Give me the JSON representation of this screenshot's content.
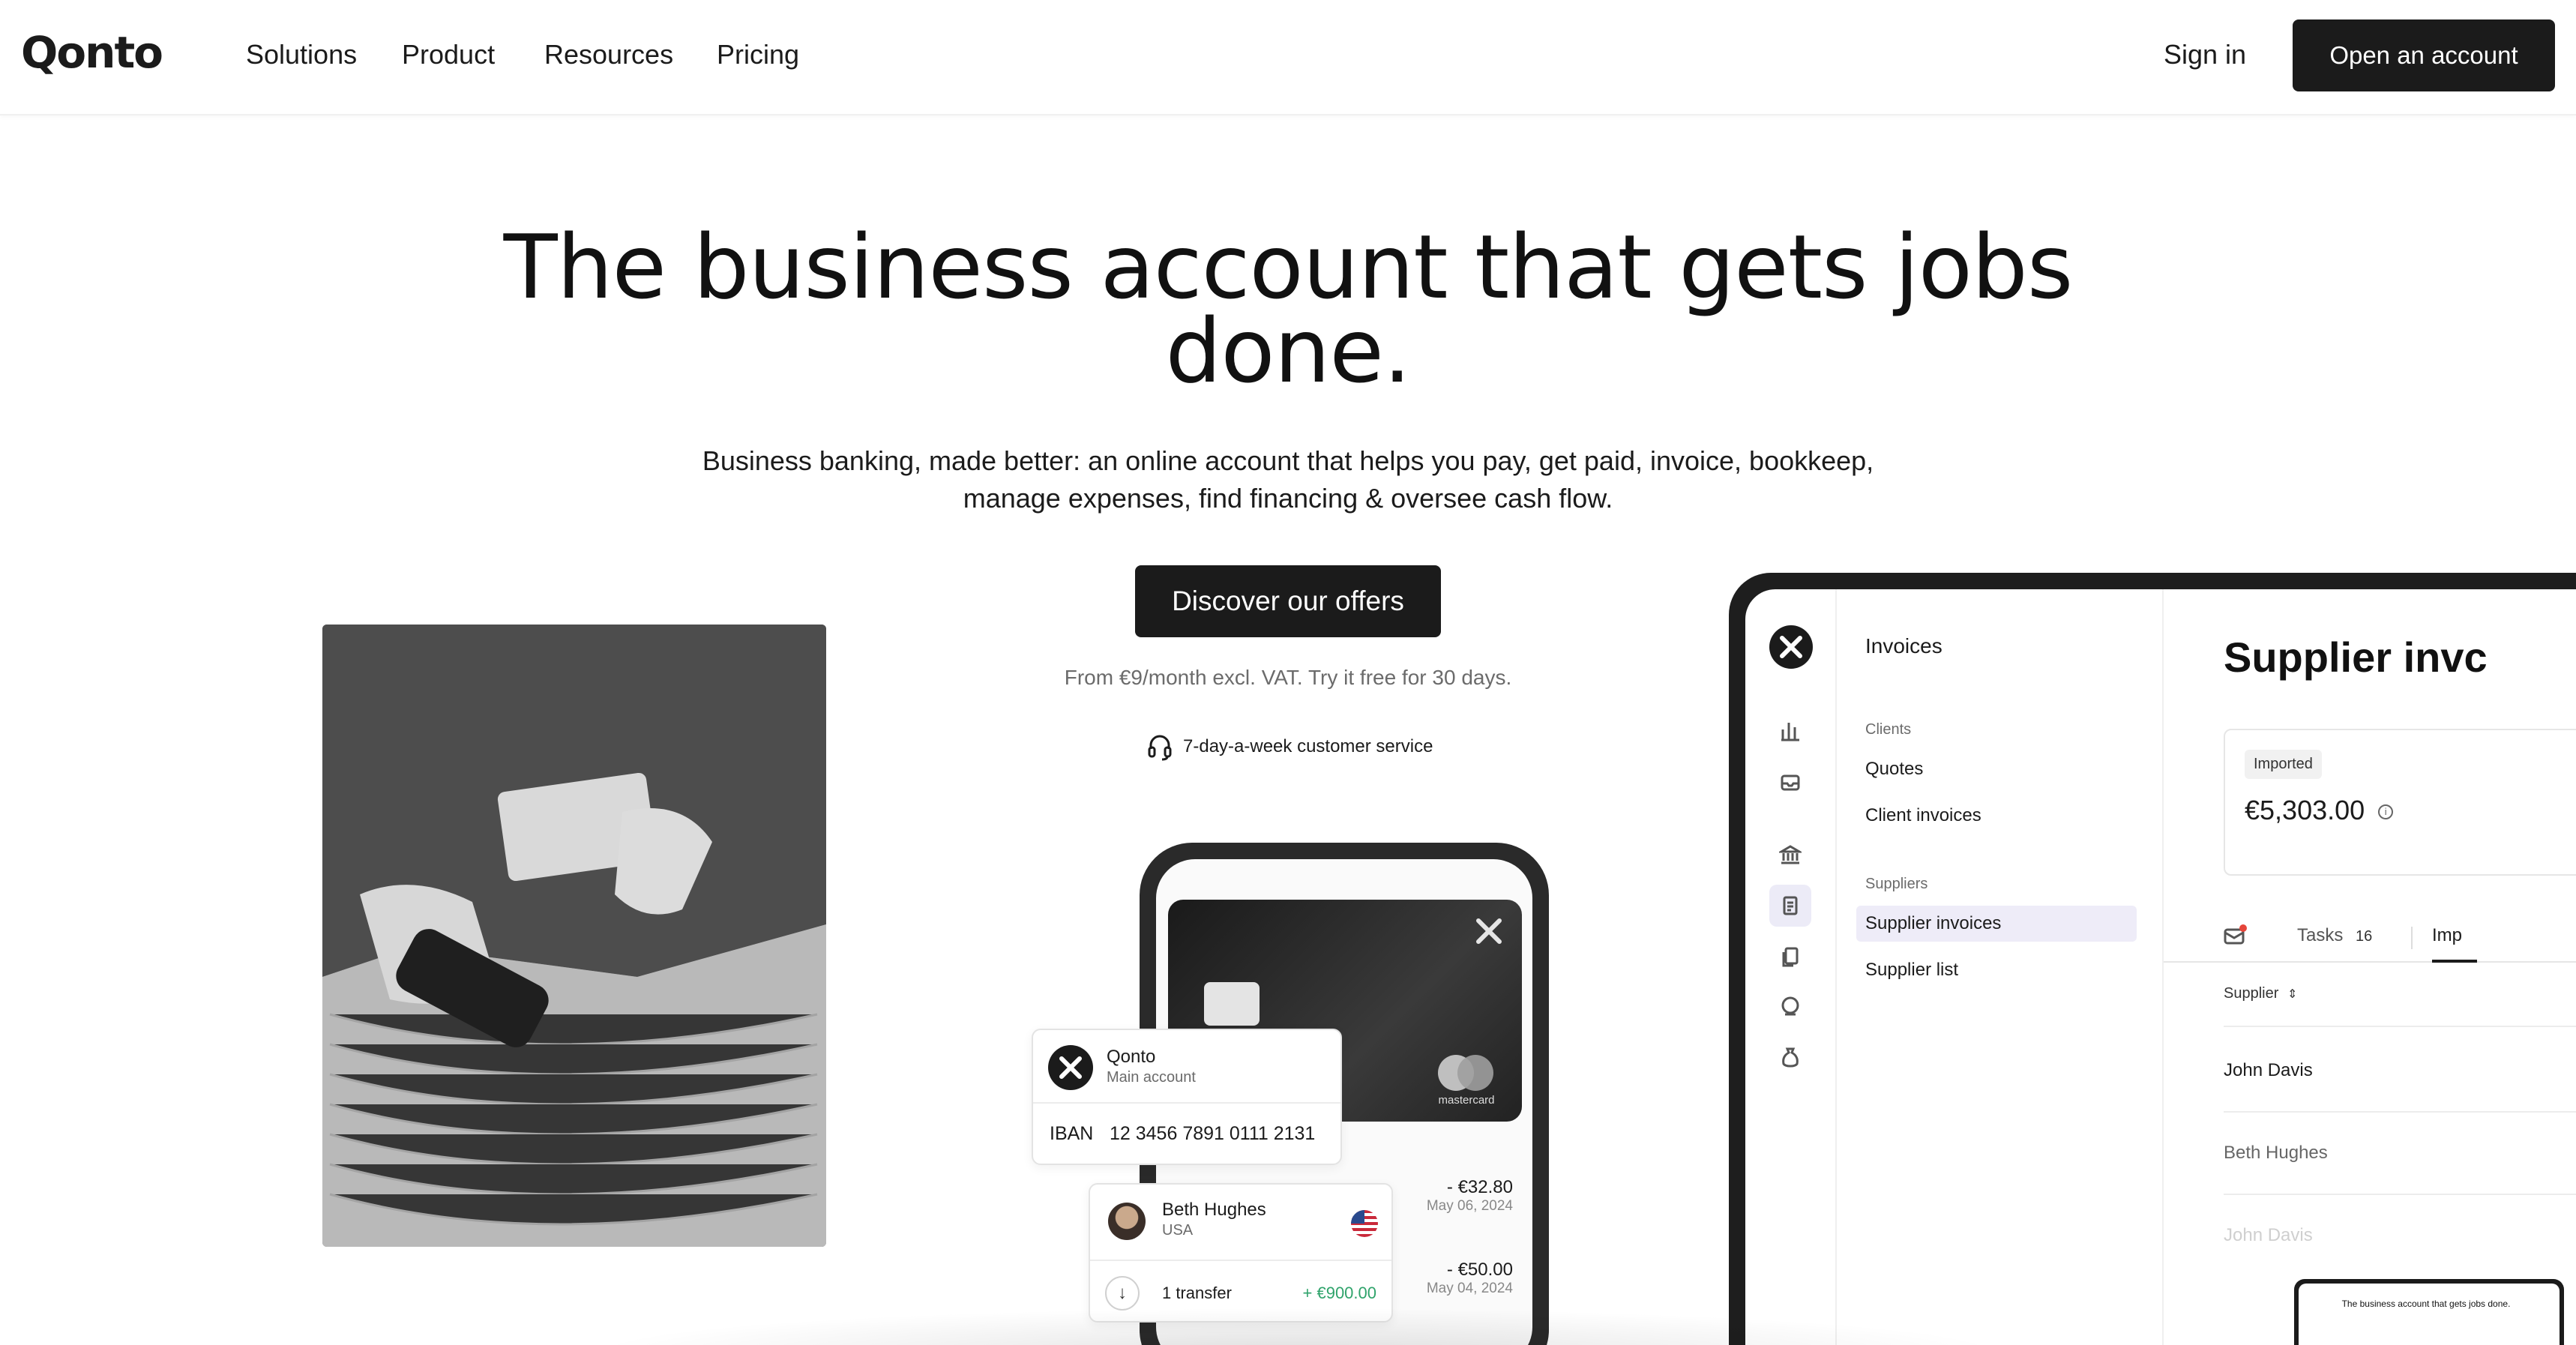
{
  "brand": {
    "logo": "Qonto"
  },
  "nav": {
    "links": [
      "Solutions",
      "Product",
      "Resources",
      "Pricing"
    ],
    "signin": "Sign in",
    "open_account": "Open an account"
  },
  "hero": {
    "title_line1": "The business account that gets jobs",
    "title_line2": "done.",
    "subtitle_line1": "Business banking, made better: an online account that helps you pay, get paid, invoice, bookkeep,",
    "subtitle_line2": "manage expenses, find financing & oversee cash flow.",
    "cta": "Discover our offers",
    "price_note": "From €9/month excl. VAT. Try it free for 30 days.",
    "service": "7-day-a-week customer service"
  },
  "phone": {
    "card_brand": "mastercard",
    "transactions": [
      {
        "amount": "- €32.80",
        "date": "May 06, 2024"
      },
      {
        "amount": "- €50.00",
        "date": "May 04, 2024"
      }
    ],
    "account": {
      "name": "Qonto",
      "sub": "Main account",
      "iban_label": "IBAN",
      "iban": "12 3456 7891 0111 2131"
    },
    "transfer": {
      "name": "Beth Hughes",
      "country": "USA",
      "label": "1 transfer",
      "amount": "+ €900.00"
    }
  },
  "tablet": {
    "menu_title": "Invoices",
    "groups": {
      "clients": "Clients",
      "suppliers": "Suppliers"
    },
    "client_items": [
      "Quotes",
      "Client invoices"
    ],
    "supplier_items": [
      "Supplier invoices",
      "Supplier list"
    ],
    "content_title": "Supplier invc",
    "badge": "Imported",
    "amount": "€5,303.00",
    "tabs": {
      "tasks": "Tasks",
      "tasks_count": "16",
      "imported": "Imp"
    },
    "column": "Supplier",
    "rows": [
      "John Davis",
      "Beth Hughes",
      "John Davis"
    ]
  },
  "thumbnail": {
    "title": "The business account that gets jobs done."
  }
}
